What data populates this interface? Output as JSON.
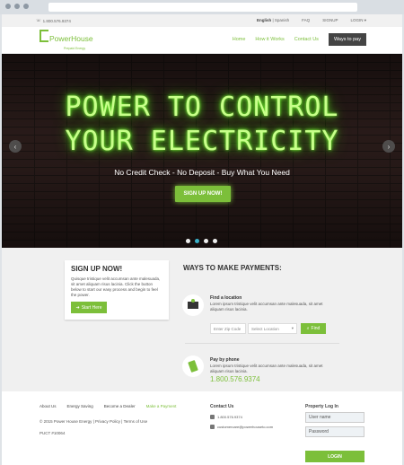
{
  "topbar": {
    "phone": "1.800.576.9374",
    "lang_english": "English",
    "lang_spanish": "Spanish",
    "faq": "FAQ",
    "signup": "SIGNUP",
    "login": "LOGIN"
  },
  "header": {
    "logo_name": "PowerHouse",
    "logo_sub": "Prepaid Energy",
    "nav": [
      "Home",
      "How it Works",
      "Contact Us"
    ],
    "pay_button": "Ways to pay"
  },
  "hero": {
    "line1": "POWER TO CONTROL",
    "line2": "YOUR ELECTRICITY",
    "tagline": "No Credit Check - No Deposit - Buy What You Need",
    "cta": "SIGN UP NOW!",
    "slides": 4,
    "active_slide": 2
  },
  "signup": {
    "title": "SIGN UP NOW!",
    "text": "Quisque tristique velit accumsan ante malesuada, sit amet aliquam risus lacinia. Click the button below to start our easy process and begin to feel the power.",
    "button": "Start Here"
  },
  "payments": {
    "title": "WAYS TO MAKE PAYMENTS:",
    "location_title": "Find a location",
    "location_text": "Lorem ipsum tristique velit accumsan ante malesuada, sit amet aliquam risus lacinia.",
    "zip_placeholder": "Enter Zip Code",
    "select_placeholder": "Select Location",
    "find_button": "Find",
    "phone_title": "Pay by phone",
    "phone_text": "Lorem ipsum tristique velit accumsan ante malesuada, sit amet aliquam risus lacinia.",
    "phone_number": "1.800.576.9374"
  },
  "footer": {
    "links": [
      "About Us",
      "Energy Saving",
      "Become a Dealer",
      "Make a Payment"
    ],
    "copyright": "© 2015 Power House Energy | Privacy Policy | Terms of Use",
    "license": "PUCT #10064",
    "contact_title": "Contact Us",
    "contact_phone": "1.800.576.9374",
    "contact_email": "customercare@powerhouseto.com",
    "login_title": "Property Log In",
    "username_placeholder": "User name",
    "password_placeholder": "Password",
    "login_button": "LOGIN"
  },
  "colors": {
    "accent": "#7cbf3a",
    "dark": "#444444",
    "indicator_active": "#3ab0c8"
  }
}
